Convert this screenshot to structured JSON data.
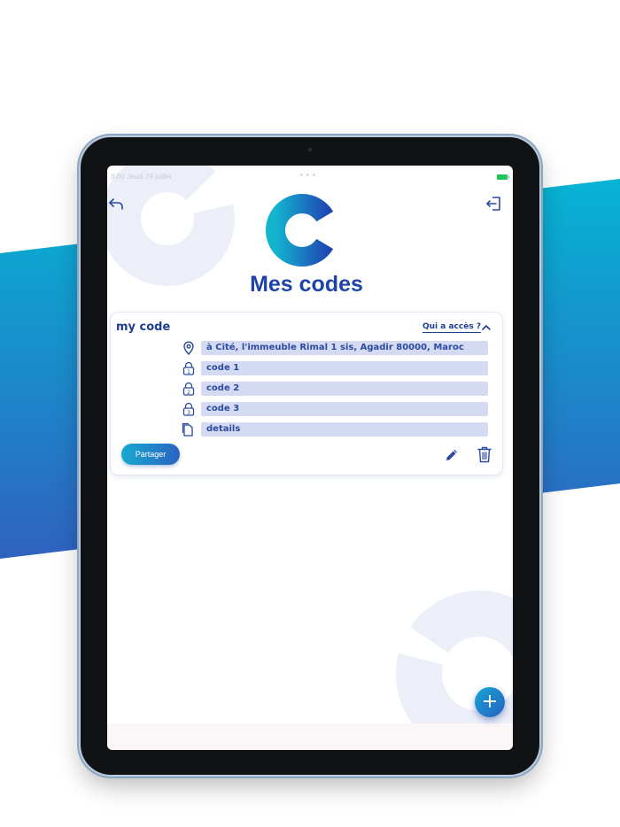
{
  "status_bar": {
    "time": "8:00",
    "date": "Jeudi 29 juillet",
    "dots": "• • •"
  },
  "header": {
    "title": "Mes codes"
  },
  "card": {
    "title": "my code",
    "access_link": "Qui a accès ?",
    "rows": [
      {
        "icon": "location-pin-icon",
        "value": "à Cité, l'immeuble Rimal 1 sis, Agadir 80000, Maroc"
      },
      {
        "icon": "lock-1-icon",
        "number": "1",
        "value": "code 1"
      },
      {
        "icon": "lock-2-icon",
        "number": "2",
        "value": "code 2"
      },
      {
        "icon": "lock-3-icon",
        "number": "3",
        "value": "code 3"
      },
      {
        "icon": "documents-icon",
        "value": "details"
      }
    ],
    "share_label": "Partager"
  },
  "fab_label": "+",
  "colors": {
    "brand_blue": "#1f44a8",
    "brand_cyan": "#18a9cf",
    "field_background": "#d4daf1",
    "band_light": "#06b4d4",
    "band_dark": "#2f62c0"
  }
}
